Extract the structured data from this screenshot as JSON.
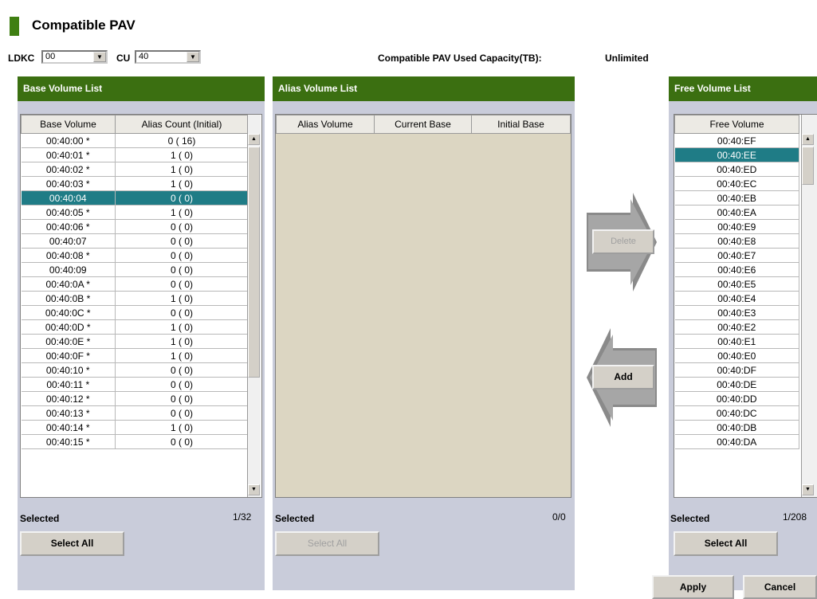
{
  "title": "Compatible PAV",
  "ldkc": {
    "label": "LDKC",
    "value": "00"
  },
  "cu": {
    "label": "CU",
    "value": "40"
  },
  "capacity": {
    "label": "Compatible PAV Used Capacity(TB):",
    "value": "Unlimited"
  },
  "base": {
    "header": "Base Volume List",
    "columns": [
      "Base Volume",
      "Alias Count (Initial)"
    ],
    "rows": [
      [
        "00:40:00 *",
        "0 ( 16)"
      ],
      [
        "00:40:01 *",
        "1 ( 0)"
      ],
      [
        "00:40:02 *",
        "1 ( 0)"
      ],
      [
        "00:40:03 *",
        "1 ( 0)"
      ],
      [
        "00:40:04",
        "0 ( 0)"
      ],
      [
        "00:40:05 *",
        "1 ( 0)"
      ],
      [
        "00:40:06 *",
        "0 ( 0)"
      ],
      [
        "00:40:07",
        "0 ( 0)"
      ],
      [
        "00:40:08 *",
        "0 ( 0)"
      ],
      [
        "00:40:09",
        "0 ( 0)"
      ],
      [
        "00:40:0A *",
        "0 ( 0)"
      ],
      [
        "00:40:0B *",
        "1 ( 0)"
      ],
      [
        "00:40:0C *",
        "0 ( 0)"
      ],
      [
        "00:40:0D *",
        "1 ( 0)"
      ],
      [
        "00:40:0E *",
        "1 ( 0)"
      ],
      [
        "00:40:0F *",
        "1 ( 0)"
      ],
      [
        "00:40:10 *",
        "0 ( 0)"
      ],
      [
        "00:40:11 *",
        "0 ( 0)"
      ],
      [
        "00:40:12 *",
        "0 ( 0)"
      ],
      [
        "00:40:13 *",
        "0 ( 0)"
      ],
      [
        "00:40:14 *",
        "1 ( 0)"
      ],
      [
        "00:40:15 *",
        "0 ( 0)"
      ]
    ],
    "selected_index": 4,
    "selected_label": "Selected",
    "selected_count": "1/32",
    "select_all": "Select All"
  },
  "alias": {
    "header": "Alias Volume List",
    "columns": [
      "Alias Volume",
      "Current Base",
      "Initial Base"
    ],
    "selected_label": "Selected",
    "selected_count": "0/0",
    "select_all": "Select All"
  },
  "actions": {
    "delete": "Delete",
    "add": "Add"
  },
  "free": {
    "header": "Free Volume List",
    "column": "Free Volume",
    "rows": [
      "00:40:EF",
      "00:40:EE",
      "00:40:ED",
      "00:40:EC",
      "00:40:EB",
      "00:40:EA",
      "00:40:E9",
      "00:40:E8",
      "00:40:E7",
      "00:40:E6",
      "00:40:E5",
      "00:40:E4",
      "00:40:E3",
      "00:40:E2",
      "00:40:E1",
      "00:40:E0",
      "00:40:DF",
      "00:40:DE",
      "00:40:DD",
      "00:40:DC",
      "00:40:DB",
      "00:40:DA"
    ],
    "selected_index": 1,
    "selected_label": "Selected",
    "selected_count": "1/208",
    "select_all": "Select All"
  },
  "footer": {
    "apply": "Apply",
    "cancel": "Cancel"
  },
  "colors": {
    "header_green": "#3b6f11",
    "selection": "#1f7c86",
    "panel_bg": "#c9ccda"
  }
}
